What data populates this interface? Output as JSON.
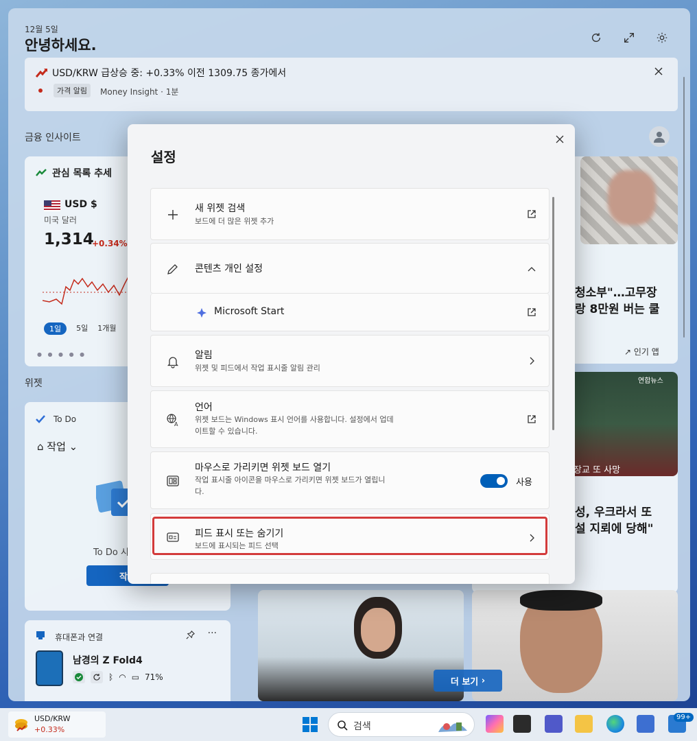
{
  "board": {
    "date": "12월 5일",
    "greeting": "안녕하세요.",
    "notice": {
      "title": "USD/KRW 급상승 중: +0.33% 이전 1309.75 종가에서",
      "tag": "가격 알림",
      "source": "Money Insight · 1분"
    },
    "finance_label": "금융 인사이트",
    "widgets_label": "위젯",
    "watchlist": {
      "title": "관심 목록 추세",
      "currency": "USD $",
      "currency_sub": "미국 달러",
      "value": "1,314",
      "change": "+0.34%",
      "ranges": [
        "1일",
        "5일",
        "1개월"
      ]
    },
    "todo": {
      "label": "To Do",
      "task": "작업",
      "empty_text": "To Do 시",
      "button": "작업"
    },
    "phone": {
      "title": "휴대폰과 연결",
      "device": "남경의 Z Fold4",
      "battery": "71%"
    },
    "news": {
      "headline1": "청소부\"…고무장\n랑 8만원 버는 쿨",
      "trending": "인기 앱",
      "badge": "연합뉴스",
      "caption": "장교 또 사망",
      "headline2": "성, 우크라서 또\n설 지뢰에 당해\"",
      "more": "더 보기"
    }
  },
  "taskbar": {
    "widget_title": "USD/KRW",
    "widget_change": "+0.33%",
    "search_placeholder": "검색",
    "badge": "99+"
  },
  "dialog": {
    "title": "설정",
    "rows": [
      {
        "title": "새 위젯 검색",
        "desc": "보드에 더 많은 위젯 추가",
        "icon": "plus-icon",
        "end": "external-link-icon"
      },
      {
        "title": "콘텐츠 개인 설정",
        "desc": "",
        "icon": "pencil-icon",
        "end": "chevron-up-icon"
      },
      {
        "title": "Microsoft Start",
        "desc": "",
        "icon": "microsoft-start-icon",
        "end": "external-link-icon"
      },
      {
        "title": "알림",
        "desc": "위젯 및 피드에서 작업 표시줄 알림 관리",
        "icon": "bell-icon",
        "end": "chevron-right-icon"
      },
      {
        "title": "언어",
        "desc": "위젯 보드는 Windows 표시 언어를 사용합니다. 설정에서 업데\n이트할 수 있습니다.",
        "icon": "language-icon",
        "end": "external-link-icon"
      },
      {
        "title": "마우스로 가리키면 위젯 보드 열기",
        "desc": "작업 표시줄 아이콘을 마우스로 가리키면 위젯 보드가 열립니\n다.",
        "icon": "widget-board-icon",
        "toggle_label": "사용",
        "toggle_on": true
      },
      {
        "title": "피드 표시 또는 숨기기",
        "desc": "보드에 표시되는 피드 선택",
        "icon": "feed-icon",
        "end": "chevron-right-icon"
      }
    ]
  },
  "colors": {
    "accent": "#005fb8",
    "highlight": "#d33b3b",
    "negative": "#c42b1c"
  }
}
